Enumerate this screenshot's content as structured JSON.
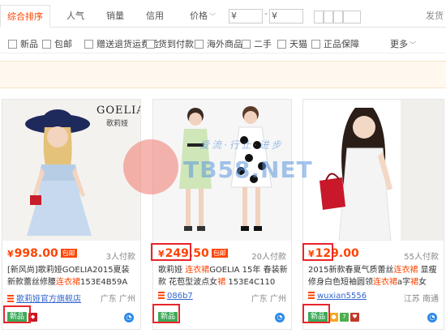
{
  "sort": {
    "tabs": [
      "综合排序",
      "人气",
      "销量",
      "信用"
    ],
    "price_label": "价格",
    "currency": "¥",
    "min_value": "",
    "max_value": "",
    "dash": "-",
    "fav_label": "发货"
  },
  "filters": {
    "options": [
      "新品",
      "包邮",
      "赠送退货运费险",
      "货到付款",
      "海外商品",
      "二手",
      "天猫",
      "正品保障"
    ],
    "more_label": "更多"
  },
  "products": [
    {
      "currency": "¥",
      "price": "998.00",
      "price_tag": "包邮",
      "sold": "3人付款",
      "title_parts": [
        {
          "t": "[新风尚]歌莉娅GOELIA2015夏装新款蕾丝修腰",
          "hl": false
        },
        {
          "t": "连衣裙",
          "hl": true
        },
        {
          "t": "153E4B59A",
          "hl": false
        }
      ],
      "shop": "歌莉娅官方旗舰店",
      "location": "广东 广州",
      "brand_logo": "GOELIA",
      "brand_logo_cn": "歌莉娅",
      "new_badge": "新品"
    },
    {
      "currency": "¥",
      "price": "249.50",
      "price_tag": "包邮",
      "sold": "20人付款",
      "title_parts": [
        {
          "t": "歌莉娅 ",
          "hl": false
        },
        {
          "t": "连衣裙",
          "hl": true
        },
        {
          "t": "GOELIA 15年 春装新款 花苞型波点女",
          "hl": false
        },
        {
          "t": "裙",
          "hl": true
        },
        {
          "t": " 153E4C110",
          "hl": false
        }
      ],
      "shop": "086b7",
      "location": "广东 广州",
      "new_badge": "新品"
    },
    {
      "currency": "¥",
      "price": "129.00",
      "price_tag": "",
      "sold": "55人付款",
      "title_parts": [
        {
          "t": "2015新款春夏气质蕾丝",
          "hl": false
        },
        {
          "t": "连衣裙",
          "hl": true
        },
        {
          "t": " 显瘦修身白色短袖圆领",
          "hl": false
        },
        {
          "t": "连衣裙",
          "hl": true
        },
        {
          "t": "a字",
          "hl": false
        },
        {
          "t": "裙",
          "hl": true
        },
        {
          "t": "女",
          "hl": false
        }
      ],
      "shop": "wuxian5556",
      "location": "江苏 南通",
      "new_badge": "新品"
    }
  ],
  "watermark": {
    "line1": "爱流·行止·进步",
    "line2": "TB58.NET"
  },
  "colors": {
    "accent": "#ff4400",
    "new_badge": "#3daa59",
    "highlight_box": "#e8252b"
  }
}
